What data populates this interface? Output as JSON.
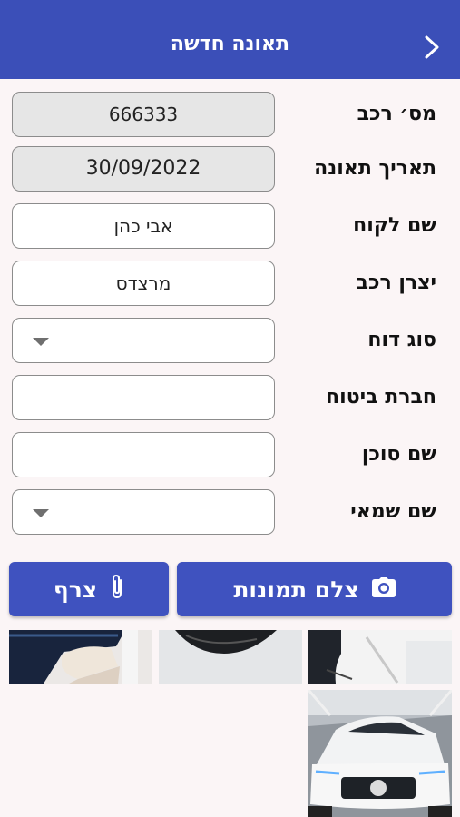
{
  "header": {
    "title": "תאונה חדשה"
  },
  "form": {
    "vehicle_number": {
      "label": "מס׳ רכב",
      "value": "666333"
    },
    "accident_date": {
      "label": "תאריך תאונה",
      "value": "30/09/2022"
    },
    "customer_name": {
      "label": "שם לקוח",
      "value": "אבי כהן"
    },
    "manufacturer": {
      "label": "יצרן רכב",
      "value": "מרצדס"
    },
    "report_type": {
      "label": "סוג דוח",
      "value": ""
    },
    "insurance_company": {
      "label": "חברת ביטוח",
      "value": ""
    },
    "agent_name": {
      "label": "שם סוכן",
      "value": ""
    },
    "appraiser_name": {
      "label": "שם שמאי",
      "value": ""
    }
  },
  "actions": {
    "take_photos": "צלם תמונות",
    "attach": "צרף"
  },
  "colors": {
    "primary": "#3b4fb8",
    "background": "#fbf5f6"
  },
  "icons": [
    "back-chevron-icon",
    "camera-icon",
    "paperclip-icon",
    "dropdown-caret-icon"
  ]
}
